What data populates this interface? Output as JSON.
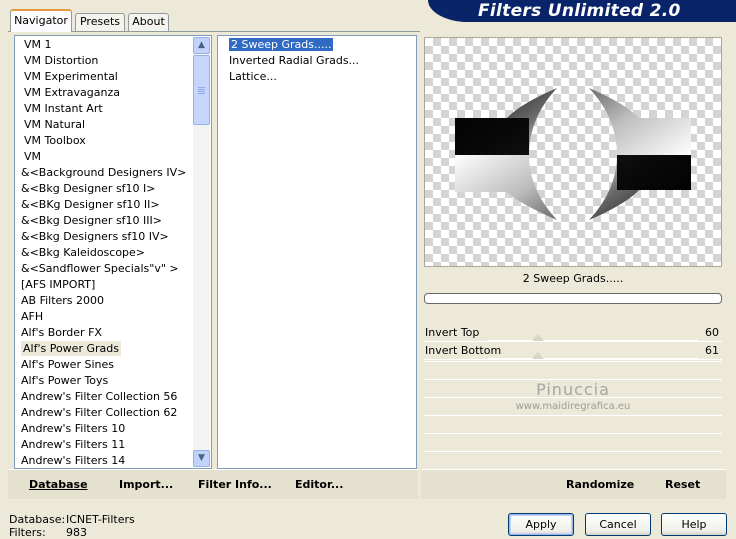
{
  "tabs": [
    {
      "label": "Navigator",
      "active": true
    },
    {
      "label": "Presets",
      "active": false
    },
    {
      "label": "About",
      "active": false
    }
  ],
  "app_title": "Filters Unlimited 2.0",
  "categories": [
    "VM 1",
    "VM Distortion",
    "VM Experimental",
    "VM Extravaganza",
    "VM Instant Art",
    "VM Natural",
    "VM Toolbox",
    "VM",
    "&<Background Designers IV>",
    "&<Bkg Designer sf10 I>",
    "&<BKg Designer sf10 II>",
    "&<Bkg Designer sf10 III>",
    "&<Bkg Designers sf10 IV>",
    "&<Bkg Kaleidoscope>",
    "&<Sandflower Specials\"v\" >",
    "[AFS IMPORT]",
    "AB Filters 2000",
    "AFH",
    "Alf's Border FX",
    "Alf's Power Grads",
    "Alf's Power Sines",
    "Alf's Power Toys",
    "Andrew's Filter Collection 56",
    "Andrew's Filter Collection 62",
    "Andrew's Filters 10",
    "Andrew's Filters 11",
    "Andrew's Filters 14"
  ],
  "selected_category": "Alf's Power Grads",
  "filters": [
    "2 Sweep Grads.....",
    "Inverted Radial Grads...",
    "Lattice..."
  ],
  "selected_filter": "2 Sweep Grads.....",
  "preview_filter_name": "2 Sweep Grads.....",
  "params": [
    {
      "label": "Invert Top",
      "value": "60",
      "fraction": 0.24
    },
    {
      "label": "Invert Bottom",
      "value": "61",
      "fraction": 0.24
    }
  ],
  "watermark": {
    "name": "Pinuccia",
    "url": "www.maidiregrafica.eu"
  },
  "commands": {
    "database": "Database",
    "import": "Import...",
    "filter_info": "Filter Info...",
    "editor": "Editor...",
    "randomize": "Randomize",
    "reset": "Reset"
  },
  "status": {
    "database_label": "Database:",
    "database_value": "ICNET-Filters",
    "filters_label": "Filters:",
    "filters_value": "983"
  },
  "buttons": {
    "apply": "Apply",
    "cancel": "Cancel",
    "help": "Help"
  },
  "colors": {
    "title_bar": "#0a246a",
    "selection": "#316ac5",
    "tab_highlight": "#e69b3b"
  }
}
